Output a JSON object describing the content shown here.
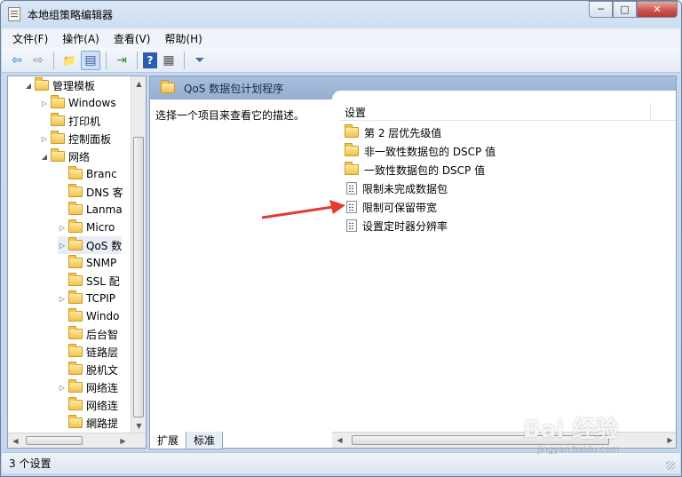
{
  "window": {
    "title": "本地组策略编辑器",
    "minimize": "─",
    "maximize": "□",
    "close": "✕"
  },
  "menu": [
    "文件(F)",
    "操作(A)",
    "查看(V)",
    "帮助(H)"
  ],
  "toolbar": {
    "icons": [
      "back-arrow",
      "forward-arrow",
      "up-folder",
      "show-hide-tree",
      "export-list",
      "help",
      "properties",
      "filter"
    ],
    "glyphs": {
      "back": "⇦",
      "forward": "⇨",
      "up": "📁",
      "tree": "▤",
      "export": "⇥",
      "help": "?",
      "properties": "▦",
      "filter": "⏷"
    }
  },
  "tree": [
    {
      "label": "管理模板",
      "arrow": "◢"
    },
    {
      "label": "Windows",
      "arrow": "▷"
    },
    {
      "label": "打印机",
      "arrow": ""
    },
    {
      "label": "控制面板",
      "arrow": "▷"
    },
    {
      "label": "网络",
      "arrow": "◢"
    },
    {
      "label": "Branc",
      "arrow": ""
    },
    {
      "label": "DNS 客",
      "arrow": ""
    },
    {
      "label": "Lanma",
      "arrow": ""
    },
    {
      "label": "Micro",
      "arrow": "▷"
    },
    {
      "label": "QoS 数",
      "arrow": "▷",
      "selected": true
    },
    {
      "label": "SNMP",
      "arrow": ""
    },
    {
      "label": "SSL 配",
      "arrow": ""
    },
    {
      "label": "TCPIP",
      "arrow": "▷"
    },
    {
      "label": "Windo",
      "arrow": ""
    },
    {
      "label": "后台智",
      "arrow": ""
    },
    {
      "label": "链路层",
      "arrow": ""
    },
    {
      "label": "脱机文",
      "arrow": ""
    },
    {
      "label": "网络连",
      "arrow": "▷"
    },
    {
      "label": "网络连",
      "arrow": ""
    },
    {
      "label": "網路提",
      "arrow": ""
    }
  ],
  "right_header": {
    "title": "QoS 数据包计划程序"
  },
  "description": "选择一个项目来查看它的描述。",
  "list": {
    "column_header": "设置",
    "rows": [
      {
        "label": "第 2 层优先级值",
        "kind": "folder"
      },
      {
        "label": "非一致性数据包的 DSCP 值",
        "kind": "folder"
      },
      {
        "label": "一致性数据包的 DSCP 值",
        "kind": "folder"
      },
      {
        "label": "限制未完成数据包",
        "kind": "setting"
      },
      {
        "label": "限制可保留带宽",
        "kind": "setting"
      },
      {
        "label": "设置定时器分辨率",
        "kind": "setting"
      }
    ]
  },
  "tabs": [
    "扩展",
    "标准"
  ],
  "status": "3 个设置",
  "watermark": {
    "main": "Bai 经验",
    "sub": "jingyan.baidu.com"
  },
  "colors": {
    "annotation": "#e53935",
    "header": "#94afd3"
  }
}
